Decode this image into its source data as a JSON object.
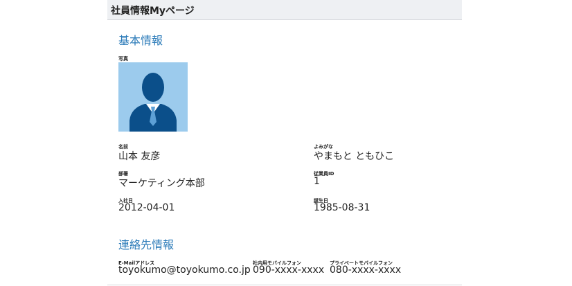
{
  "header": {
    "title": "社員情報Myページ"
  },
  "basic": {
    "section_title": "基本情報",
    "photo_label": "写真",
    "name_label": "名前",
    "name_value": "山本 友彦",
    "kana_label": "よみがな",
    "kana_value": "やまもと ともひこ",
    "dept_label": "部署",
    "dept_value": "マーケティング本部",
    "emp_id_label": "従業員ID",
    "emp_id_value": "1",
    "join_label": "入社日",
    "join_value": "2012-04-01",
    "birth_label": "誕生日",
    "birth_value": "1985-08-31"
  },
  "contact": {
    "section_title": "連絡先情報",
    "email_label": "E-Mailアドレス",
    "email_value": "toyokumo@toyokumo.co.jp",
    "company_mobile_label": "社内用モバイルフォン",
    "company_mobile_value": "090-xxxx-xxxx",
    "private_mobile_label": "プライベートモバイルフォン",
    "private_mobile_value": "080-xxxx-xxxx"
  },
  "colors": {
    "accent": "#2a7ab8",
    "photo_bg": "#9ccbed",
    "avatar": "#0b4f8a",
    "header_bg": "#eef0f3"
  },
  "icons": {
    "photo": "user-avatar-icon"
  }
}
